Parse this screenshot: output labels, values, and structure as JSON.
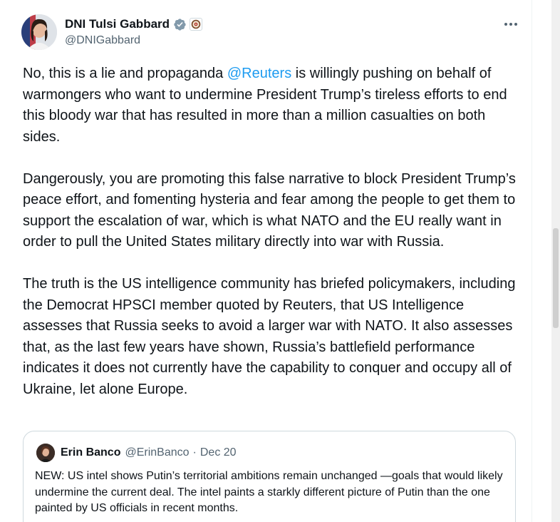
{
  "tweet": {
    "author": {
      "display_name": "DNI Tulsi Gabbard",
      "handle": "@DNIGabbard",
      "verified_icon": "verified-badge-icon",
      "affiliation_icon": "dni-seal-icon"
    },
    "more_icon": "more-dots-icon",
    "paragraphs": [
      {
        "before_mention": "No, this is a lie and propaganda ",
        "mention": "@Reuters",
        "after_mention": " is willingly pushing on behalf of warmongers who want to undermine President Trump’s tireless efforts to end this bloody war that has resulted in more than a million casualties on both sides."
      },
      {
        "text": "Dangerously, you are promoting this false narrative to block President Trump’s peace effort, and fomenting hysteria and fear among the people to get them to support the escalation of war, which is what NATO and the EU really want in order to pull the United States military directly into war with Russia."
      },
      {
        "text": "The truth is the US intelligence community has briefed policymakers, including the Democrat HPSCI member quoted by Reuters, that US Intelligence assesses that Russia seeks to avoid a larger war with NATO. It also assesses that, as the last few years have shown, Russia’s battlefield performance indicates it does not currently have the capability to conquer and occupy all of Ukraine, let alone Europe."
      }
    ]
  },
  "quote": {
    "display_name": "Erin Banco",
    "handle": "@ErinBanco",
    "separator": "·",
    "date": "Dec 20",
    "text": "NEW: US intel shows Putin’s territorial ambitions remain unchanged —goals that would likely undermine the current deal. The intel paints a starkly different picture of Putin than the one painted by US officials in recent months."
  },
  "colors": {
    "text": "#0f1419",
    "secondary": "#536471",
    "link": "#1d9bf0",
    "border": "#cfd9de"
  }
}
